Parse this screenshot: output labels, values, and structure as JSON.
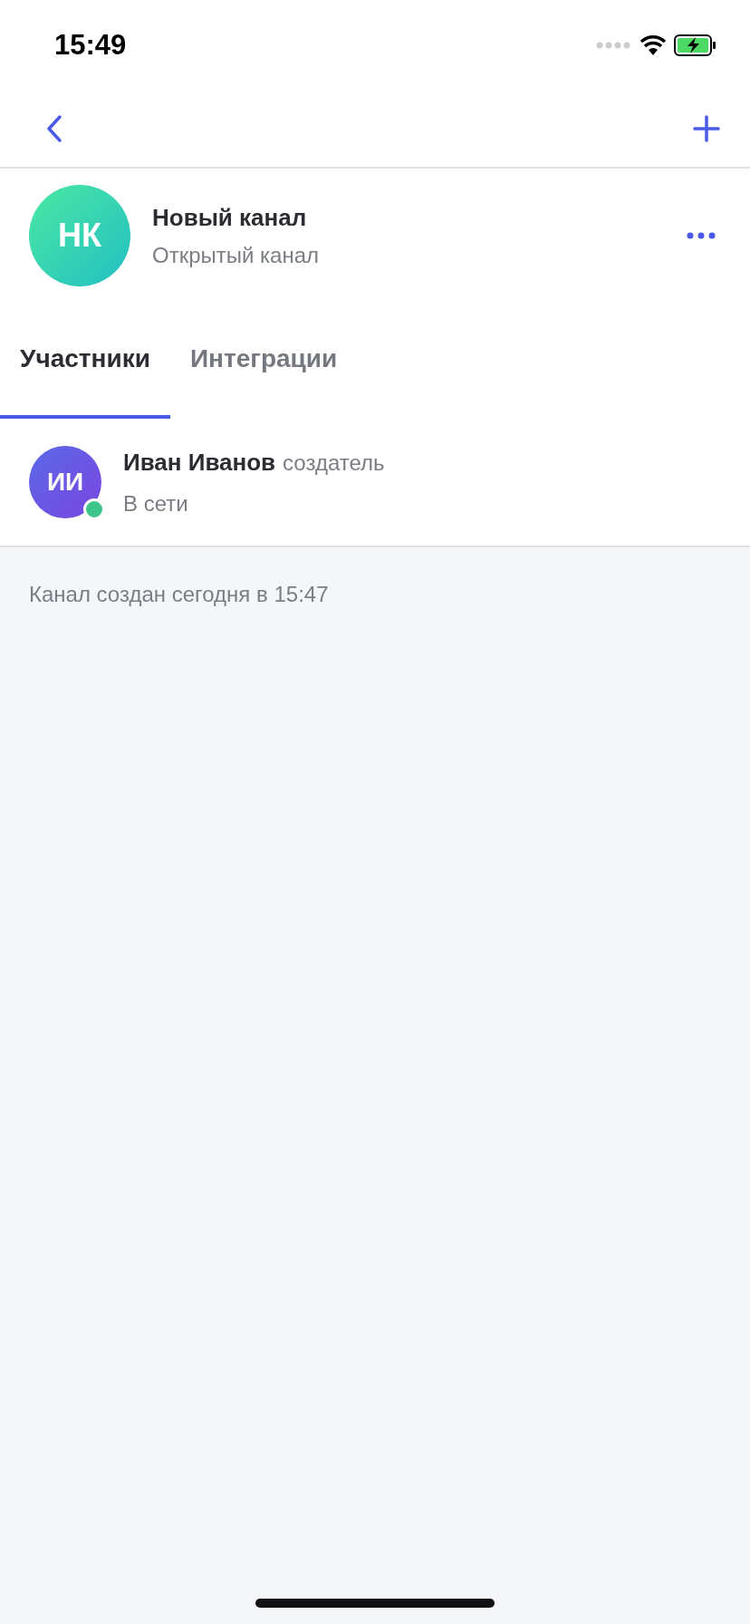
{
  "status_bar": {
    "time": "15:49"
  },
  "channel": {
    "initials": "НК",
    "name": "Новый канал",
    "type": "Открытый канал"
  },
  "tabs": [
    {
      "label": "Участники",
      "selected": true
    },
    {
      "label": "Интеграции",
      "selected": false
    }
  ],
  "members": [
    {
      "initials": "ИИ",
      "name": "Иван Иванов",
      "role": "создатель",
      "status": "В сети",
      "online": true
    }
  ],
  "footer_note": "Канал создан сегодня в 15:47"
}
